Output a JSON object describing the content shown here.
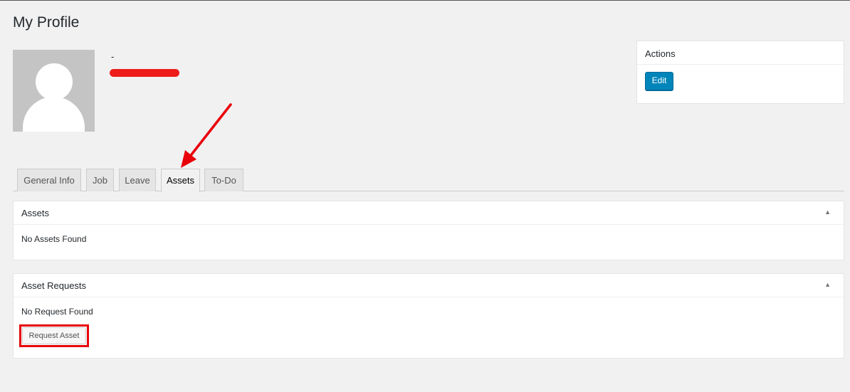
{
  "page": {
    "title": "My Profile"
  },
  "profile": {
    "name": "-"
  },
  "actions": {
    "title": "Actions",
    "edit_label": "Edit"
  },
  "tabs": [
    {
      "label": "General Info"
    },
    {
      "label": "Job"
    },
    {
      "label": "Leave"
    },
    {
      "label": "Assets",
      "active": true
    },
    {
      "label": "To-Do"
    }
  ],
  "assets_box": {
    "title": "Assets",
    "message": "No Assets Found",
    "toggle": "▲"
  },
  "requests_box": {
    "title": "Asset Requests",
    "message": "No Request Found",
    "button_label": "Request Asset",
    "toggle": "▲"
  },
  "colors": {
    "primary": "#0085ba",
    "annotation": "#e8000b",
    "background": "#f1f1f1"
  }
}
